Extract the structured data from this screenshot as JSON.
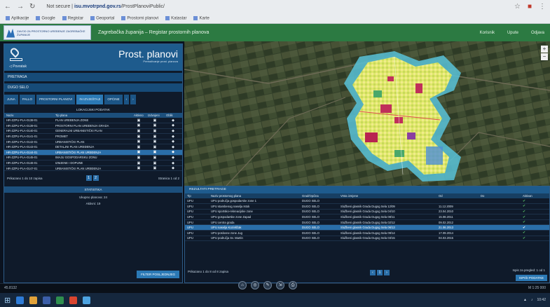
{
  "browser": {
    "url_prefix": "Not secure | ",
    "url_host": "isu.mvotrpnd.gov.rs",
    "url_path": "/ProstPlanoviPublic/"
  },
  "app": {
    "title": "Zagrebačka županija – Registar prostornih planova",
    "logo_text": "ZAVOD ZA PROSTORNO UREĐENJE ZAGREBAČKE ŽUPANIJE",
    "header_links": [
      "Korisnik",
      "Upute",
      "Odjava"
    ]
  },
  "panel": {
    "title": "Prost. planovi",
    "subtitle": "Pretraživanje prost. planova",
    "back_label": "Povratak",
    "search_label": "PRETRAGA",
    "selected_label": "DUGO SELO",
    "tabs": [
      "JUNA",
      "PALLO",
      "PROSTORNI PLANOVI",
      "IN IZVJEŠTAJI",
      "OPĆINE"
    ],
    "list_title": "LOKACIJSKI PODATAK",
    "columns": [
      "Naziv",
      "Tip plana",
      "Aktivno",
      "Izdvojeni",
      "Oblik"
    ],
    "rows": [
      {
        "id": "HR-ZZPU-PLA-0138-01",
        "name": "PLAN UREĐENJA ZONE"
      },
      {
        "id": "HR-ZZPU-PLA-0139-01",
        "name": "PROSTORNI PLAN UREĐENJA GRADA"
      },
      {
        "id": "HR-ZZPU-PLA-0140-01",
        "name": "GENERALNI URBANISTIČKI PLAN"
      },
      {
        "id": "HR-ZZPU-PLA-0141-01",
        "name": "PROMET"
      },
      {
        "id": "HR-ZZPU-PLA-0142-01",
        "name": "URBANISTIČKI PLAN"
      },
      {
        "id": "HR-ZZPU-PLA-0143-01",
        "name": "DETALJNI PLAN UREĐENJA"
      },
      {
        "id": "HR-ZZPU-PLA-0144-01",
        "name": "URBANISTIČKI PLAN UREĐENJA"
      },
      {
        "id": "HR-ZZPU-PLA-0145-01",
        "name": "IMAJU GOSPODARSKU ZONU"
      },
      {
        "id": "HR-ZZPU-PLA-0146-01",
        "name": "IZMJENE I DOPUNE"
      },
      {
        "id": "HR-ZZPU-PLA-0147-01",
        "name": "URBANISTIČKI PLAN UREĐENJA"
      }
    ],
    "pager_left": "Prikazano 1 do 10 zapisa",
    "pager_right": "Stranica 1 od 2",
    "pages": [
      "1",
      "2"
    ],
    "stat_title": "STATISTIKA",
    "stat_line1": "Ukupno planova: 24",
    "stat_line2": "Aktivni: 19",
    "filter_button": "FILTER POSLJEDNJEG"
  },
  "map": {
    "zoom_in": "+",
    "zoom_out": "−"
  },
  "results": {
    "title": "REZULTATI PRETRAGE",
    "columns": [
      "Tip",
      "Naziv prostornog plana",
      "Grad/Općina",
      "Vrsta izmjene",
      "Od",
      "Do",
      "Aktivan"
    ],
    "rows": [
      {
        "tip": "UPU",
        "name": "UPU područja gospodarske zone 1",
        "grad": "DUGO SELO",
        "vrsta": "",
        "od": "",
        "do": ""
      },
      {
        "tip": "UPU",
        "name": "UPU stambenog naselja Istok",
        "grad": "DUGO SELO",
        "vrsta": "Službeni glasnik Grada Dugog Sela 12/09",
        "od": "11.12.2009",
        "do": ""
      },
      {
        "tip": "UPU",
        "name": "UPU sportsko-rekreacijske zone",
        "grad": "DUGO SELO",
        "vrsta": "Službeni glasnik Grada Dugog Sela 04/10",
        "od": "23.04.2010",
        "do": ""
      },
      {
        "tip": "UPU",
        "name": "UPU gospodarske zone Zapad",
        "grad": "DUGO SELO",
        "vrsta": "Službeni glasnik Grada Dugog Sela 08/11",
        "od": "15.08.2011",
        "do": ""
      },
      {
        "tip": "UPU",
        "name": "UPU centra grada",
        "grad": "DUGO SELO",
        "vrsta": "Službeni glasnik Grada Dugog Sela 02/12",
        "od": "09.02.2012",
        "do": ""
      },
      {
        "tip": "UPU",
        "name": "UPU naselja Kozinščak",
        "grad": "DUGO SELO",
        "vrsta": "Službeni glasnik Grada Dugog Sela 06/13",
        "od": "21.06.2013",
        "do": ""
      },
      {
        "tip": "UPU",
        "name": "UPU poslovne zone Jug",
        "grad": "DUGO SELO",
        "vrsta": "Službeni glasnik Grada Dugog Sela 09/14",
        "od": "17.09.2014",
        "do": ""
      },
      {
        "tip": "UPU",
        "name": "UPU područja Sv. Martin",
        "grad": "DUGO SELO",
        "vrsta": "Službeni glasnik Grada Dugog Sela 03/15",
        "od": "04.03.2015",
        "do": ""
      }
    ],
    "footer_left": "Prikazano 1 do 8 od 8 zapisa",
    "footer_page": "1",
    "footer_right": "Ispis za pregled: 1 od 1",
    "print_button": "ISPIŠI PODATKE"
  },
  "toolbar": {
    "coords": "45.8132",
    "scale": "M 1:25 000",
    "tools": [
      "⌂",
      "◎",
      "✎",
      "⇲",
      "⎙"
    ]
  }
}
